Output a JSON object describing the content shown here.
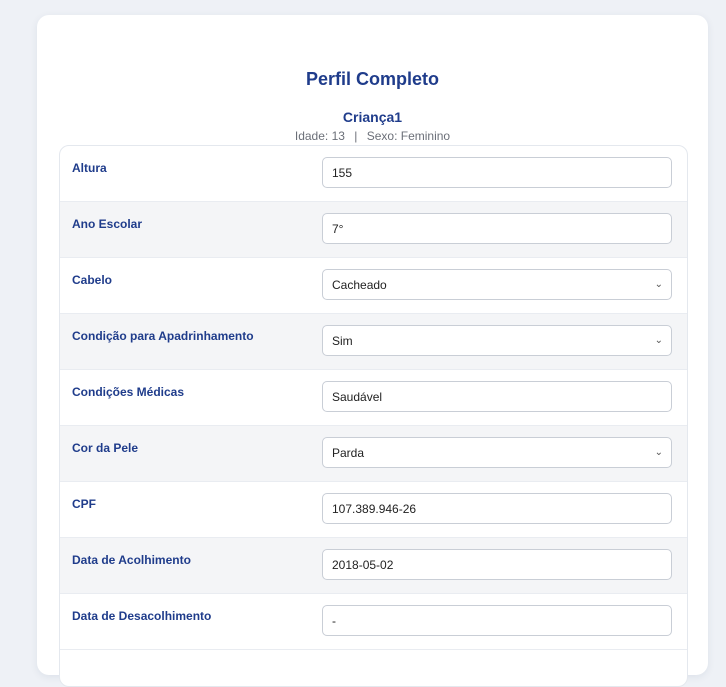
{
  "header": {
    "title": "Perfil Completo",
    "child_name": "Criança1",
    "age_text": "Idade: 13",
    "separator": "|",
    "sex_text": "Sexo: Feminino"
  },
  "fields": [
    {
      "label": "Altura",
      "value": "155",
      "type": "input"
    },
    {
      "label": "Ano Escolar",
      "value": "7°",
      "type": "input"
    },
    {
      "label": "Cabelo",
      "value": "Cacheado",
      "type": "select"
    },
    {
      "label": "Condição para Apadrinhamento",
      "value": "Sim",
      "type": "select"
    },
    {
      "label": "Condições Médicas",
      "value": "Saudável",
      "type": "input"
    },
    {
      "label": "Cor da Pele",
      "value": "Parda",
      "type": "select"
    },
    {
      "label": "CPF",
      "value": "107.389.946-26",
      "type": "input"
    },
    {
      "label": "Data de Acolhimento",
      "value": "2018-05-02",
      "type": "input"
    },
    {
      "label": "Data de Desacolhimento",
      "value": "-",
      "type": "input"
    }
  ],
  "icons": {
    "select_arrow": "chevron-down-icon"
  }
}
